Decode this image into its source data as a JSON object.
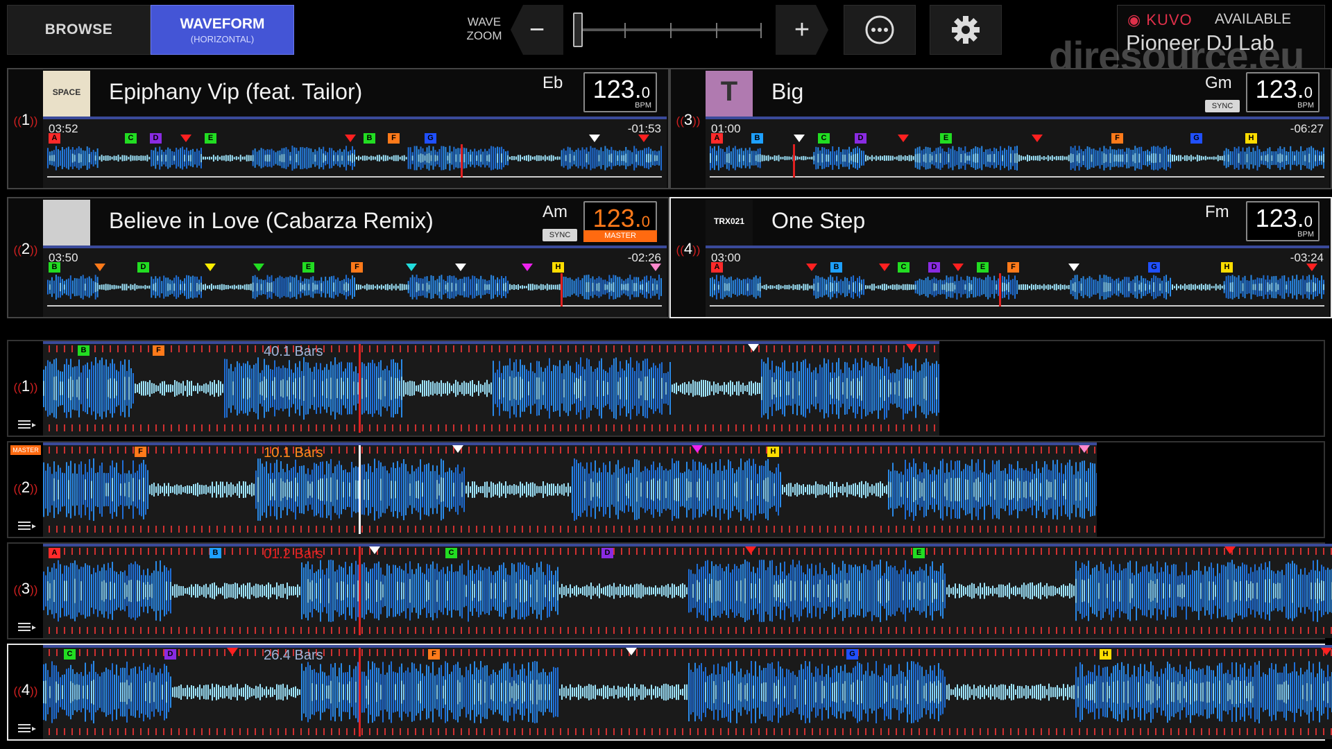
{
  "top_bar": {
    "browse_label": "BROWSE",
    "waveform_label": "WAVEFORM",
    "waveform_sub": "(HORIZONTAL)",
    "wave_zoom_line1": "WAVE",
    "wave_zoom_line2": "ZOOM",
    "zoom_minus": "−",
    "zoom_plus": "+",
    "kuvo_logo": "◉ KUVO",
    "kuvo_status": "AVAILABLE",
    "kuvo_venue": "Pioneer DJ Lab"
  },
  "watermark": "djresource.eu",
  "decks": [
    {
      "num": "1",
      "title": "Epiphany Vip (feat. Tailor)",
      "key": "Eb",
      "bpm_int": "123.",
      "bpm_dec": "0",
      "bpm_unit": "BPM",
      "elapsed": "03:52",
      "remaining": "-01:53",
      "sync_label": "",
      "master_label": "",
      "art_label": "SPACE",
      "playhead_frac": 0.67
    },
    {
      "num": "3",
      "title": "Big",
      "key": "Gm",
      "bpm_int": "123.",
      "bpm_dec": "0",
      "bpm_unit": "BPM",
      "elapsed": "01:00",
      "remaining": "-06:27",
      "sync_label": "SYNC",
      "master_label": "",
      "art_label": "T",
      "playhead_frac": 0.14
    },
    {
      "num": "2",
      "title": "Believe in Love (Cabarza Remix)",
      "key": "Am",
      "bpm_int": "123.",
      "bpm_dec": "0",
      "bpm_unit": "BPM",
      "elapsed": "03:50",
      "remaining": "-02:26",
      "sync_label": "SYNC",
      "master_label": "MASTER",
      "art_label": "",
      "playhead_frac": 0.83
    },
    {
      "num": "4",
      "title": "One Step",
      "key": "Fm",
      "bpm_int": "123.",
      "bpm_dec": "0",
      "bpm_unit": "BPM",
      "elapsed": "03:00",
      "remaining": "-03:24",
      "sync_label": "",
      "master_label": "",
      "art_label": "TRX021",
      "playhead_frac": 0.47
    }
  ],
  "lanes": [
    {
      "num": "1",
      "bars": "40.1 Bars",
      "bars_color": "#9fb4d8",
      "master": ""
    },
    {
      "num": "2",
      "bars": "10.1 Bars",
      "bars_color": "#ff8a1a",
      "master": "MASTER"
    },
    {
      "num": "3",
      "bars": "01.2 Bars",
      "bars_color": "#e02020",
      "master": ""
    },
    {
      "num": "4",
      "bars": "26.4 Bars",
      "bars_color": "#9fb4d8",
      "master": ""
    }
  ],
  "cue_colors": {
    "A": "#ff2a2a",
    "B": "#22cc22",
    "C": "#22dd22",
    "D": "#8a2be2",
    "E": "#22dd22",
    "F": "#ff7a1a",
    "G": "#2050ff",
    "H": "#ffdd00",
    "B2": "#1ea0ff"
  }
}
